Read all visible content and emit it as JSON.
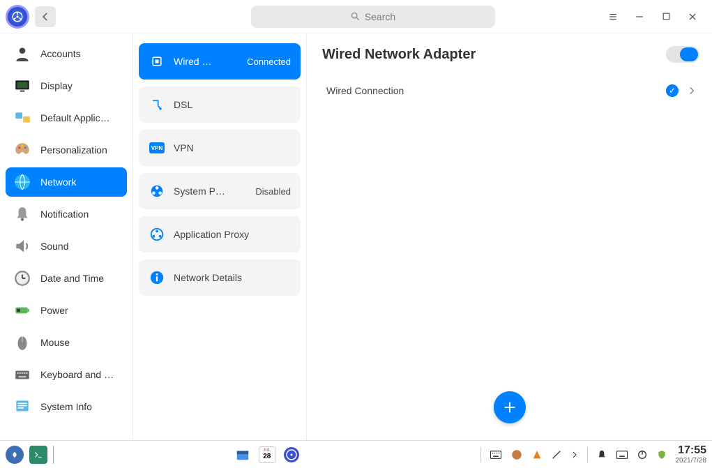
{
  "titlebar": {
    "search_placeholder": "Search"
  },
  "sidebar": {
    "items": [
      {
        "label": "Accounts"
      },
      {
        "label": "Display"
      },
      {
        "label": "Default Applic…"
      },
      {
        "label": "Personalization"
      },
      {
        "label": "Network"
      },
      {
        "label": "Notification"
      },
      {
        "label": "Sound"
      },
      {
        "label": "Date and Time"
      },
      {
        "label": "Power"
      },
      {
        "label": "Mouse"
      },
      {
        "label": "Keyboard and …"
      },
      {
        "label": "System Info"
      }
    ],
    "active_index": 4
  },
  "subpanel": {
    "items": [
      {
        "label": "Wired …",
        "status": "Connected"
      },
      {
        "label": "DSL",
        "status": ""
      },
      {
        "label": "VPN",
        "status": ""
      },
      {
        "label": "System P…",
        "status": "Disabled"
      },
      {
        "label": "Application Proxy",
        "status": ""
      },
      {
        "label": "Network Details",
        "status": ""
      }
    ],
    "active_index": 0
  },
  "detail": {
    "title": "Wired Network Adapter",
    "toggle_on": true,
    "connection_label": "Wired Connection"
  },
  "taskbar": {
    "time": "17:55",
    "date": "2021/7/28",
    "calendar_day": "28"
  }
}
